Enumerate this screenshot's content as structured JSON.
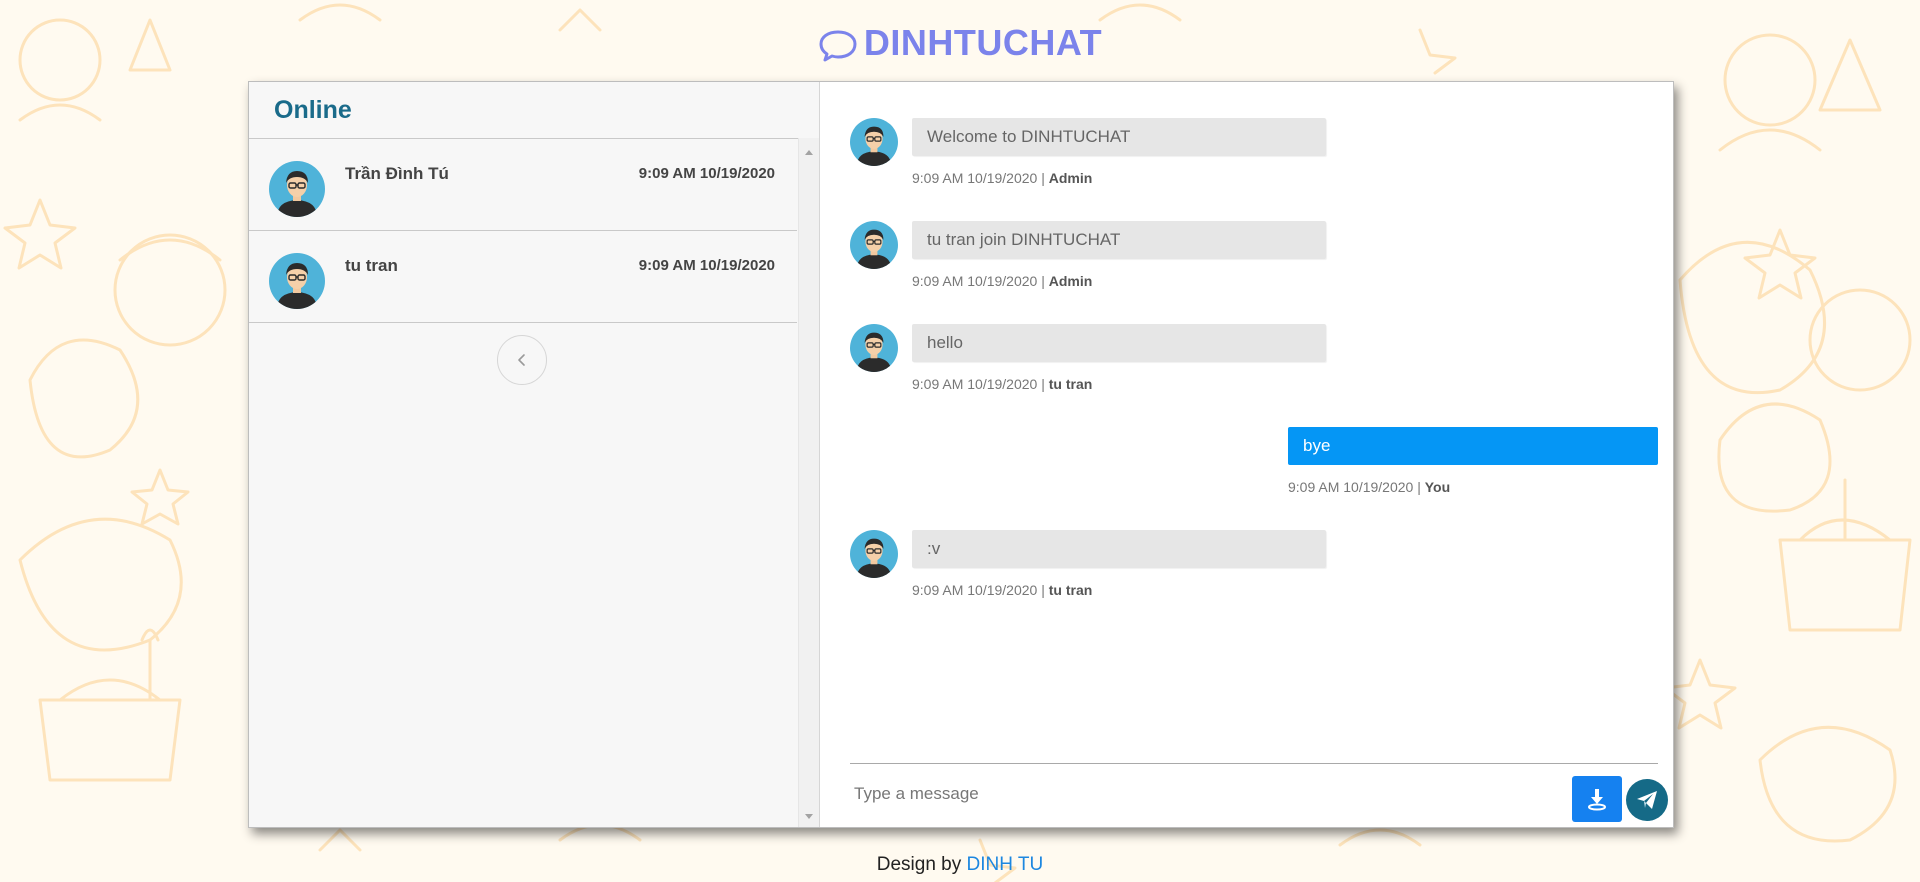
{
  "header": {
    "title": "DINHTUCHAT"
  },
  "sidebar": {
    "title": "Online",
    "users": [
      {
        "name": "Trần Đình Tú",
        "time": "9:09 AM 10/19/2020"
      },
      {
        "name": "tu tran",
        "time": "9:09 AM 10/19/2020"
      }
    ]
  },
  "chat": {
    "messages": [
      {
        "text": "Welcome to DINHTUCHAT",
        "time": "9:09 AM 10/19/2020",
        "sep": "|",
        "sender": "Admin"
      },
      {
        "text": "tu tran join DINHTUCHAT",
        "time": "9:09 AM 10/19/2020",
        "sep": "|",
        "sender": "Admin"
      },
      {
        "text": "hello",
        "time": "9:09 AM 10/19/2020",
        "sep": "|",
        "sender": "tu tran"
      },
      {
        "text": "bye",
        "time": "9:09 AM 10/19/2020",
        "sep": "|",
        "sender": "You"
      },
      {
        "text": ":v",
        "time": "9:09 AM 10/19/2020",
        "sep": "|",
        "sender": "tu tran"
      }
    ],
    "composer": {
      "placeholder": "Type a message"
    }
  },
  "footer": {
    "prefix": "Design by",
    "author": "DINH TU"
  },
  "colors": {
    "brand": "#7b83eb",
    "sidebar_title": "#1a6b8a",
    "sent_bubble": "#0596f5",
    "received_bubble": "#e6e6e6",
    "attach_button": "#1581f0",
    "send_button": "#156a87",
    "background_doodle": "#fde8c4"
  },
  "icons": {
    "logo": "chat-bubble-icon",
    "collapse": "chevron-left-icon",
    "attach": "download-icon",
    "send": "paper-plane-icon"
  }
}
